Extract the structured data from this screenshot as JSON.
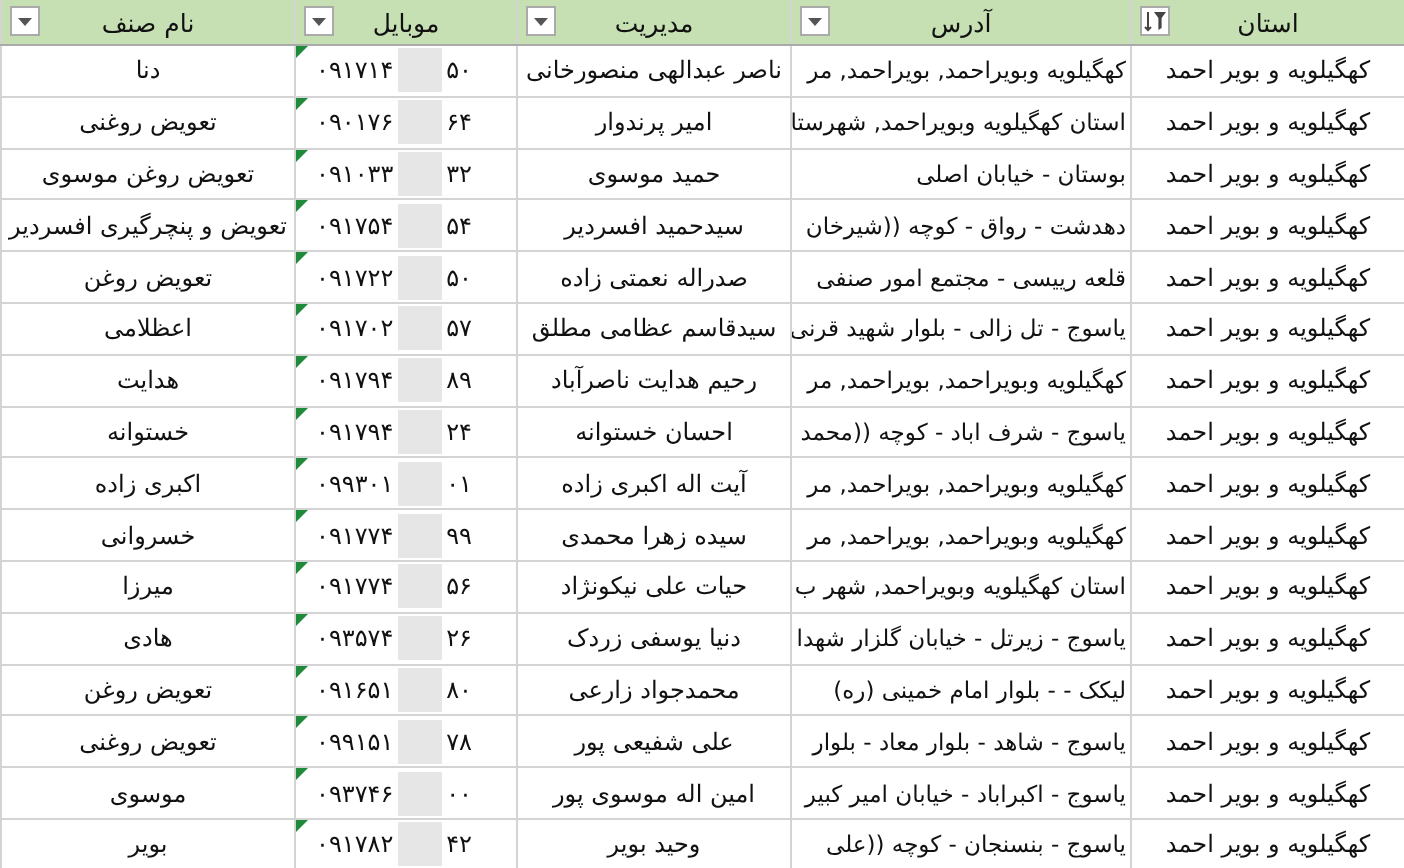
{
  "table": {
    "columns": [
      {
        "label": "استان",
        "sorted": true
      },
      {
        "label": "آدرس",
        "sorted": false
      },
      {
        "label": "مدیریت",
        "sorted": false
      },
      {
        "label": "موبایل",
        "sorted": false
      },
      {
        "label": "نام صنف",
        "sorted": false
      }
    ],
    "rows": [
      {
        "province": "کهگیلویه و بویر احمد",
        "address": "کهگیلویه وبویراحمد, بویراحمد, مر",
        "manager": "ناصر عبدالهی منصورخانی",
        "mobile_start": "۰۹۱۷۱۴",
        "mobile_end": "۵۰",
        "business": "دنا"
      },
      {
        "province": "کهگیلویه و بویر احمد",
        "address": "استان کهگیلویه وبویراحمد, شهرستا",
        "manager": "امیر پرندوار",
        "mobile_start": "۰۹۰۱۷۶",
        "mobile_end": "۶۴",
        "business": "تعویض روغنی"
      },
      {
        "province": "کهگیلویه و بویر احمد",
        "address": "بوستان  - خیابان اصلی",
        "manager": "حمید موسوی",
        "mobile_start": "۰۹۱۰۳۳",
        "mobile_end": "۳۲",
        "business": "تعویض روغن موسوی"
      },
      {
        "province": "کهگیلویه و بویر احمد",
        "address": "دهدشت - رواق - کوچه ((شیرخان",
        "manager": "سیدحمید افسردیر",
        "mobile_start": "۰۹۱۷۵۴",
        "mobile_end": "۵۴",
        "business": "تعویض و پنچرگیری افسردیر"
      },
      {
        "province": "کهگیلویه و بویر احمد",
        "address": "قلعه رییسی - مجتمع امور صنفی",
        "manager": "صدراله نعمتی زاده",
        "mobile_start": "۰۹۱۷۲۲",
        "mobile_end": "۵۰",
        "business": "تعویض روغن"
      },
      {
        "province": "کهگیلویه و بویر احمد",
        "address": "یاسوج - تل زالی - بلوار شهید قرنی",
        "manager": "سیدقاسم عظامی مطلق",
        "mobile_start": "۰۹۱۷۰۲",
        "mobile_end": "۵۷",
        "business": "اعظلامی"
      },
      {
        "province": "کهگیلویه و بویر احمد",
        "address": "کهگیلویه وبویراحمد, بویراحمد, مر",
        "manager": "رحیم هدایت ناصرآباد",
        "mobile_start": "۰۹۱۷۹۴",
        "mobile_end": "۸۹",
        "business": "هدایت"
      },
      {
        "province": "کهگیلویه و بویر احمد",
        "address": "یاسوج - شرف اباد - کوچه ((محمد",
        "manager": "احسان خستوانه",
        "mobile_start": "۰۹۱۷۹۴",
        "mobile_end": "۲۴",
        "business": "خستوانه"
      },
      {
        "province": "کهگیلویه و بویر احمد",
        "address": "کهگیلویه وبویراحمد, بویراحمد, مر",
        "manager": "آیت اله اکبری زاده",
        "mobile_start": "۰۹۹۳۰۱",
        "mobile_end": "۰۱",
        "business": "اکبری زاده"
      },
      {
        "province": "کهگیلویه و بویر احمد",
        "address": "کهگیلویه وبویراحمد, بویراحمد, مر",
        "manager": "سیده زهرا محمدی",
        "mobile_start": "۰۹۱۷۷۴",
        "mobile_end": "۹۹",
        "business": "خسروانی"
      },
      {
        "province": "کهگیلویه و بویر احمد",
        "address": "استان کهگیلویه وبویراحمد,  شهر ب",
        "manager": "حیات علی نیکونژاد",
        "mobile_start": "۰۹۱۷۷۴",
        "mobile_end": "۵۶",
        "business": "میرزا"
      },
      {
        "province": "کهگیلویه و بویر احمد",
        "address": "یاسوج - زیرتل - خیابان گلزار شهدا",
        "manager": "دنیا یوسفی زردک",
        "mobile_start": "۰۹۳۵۷۴",
        "mobile_end": "۲۶",
        "business": "هادی"
      },
      {
        "province": "کهگیلویه و بویر احمد",
        "address": "لیکک -  - بلوار امام خمینی (ره)",
        "manager": "محمدجواد زارعی",
        "mobile_start": "۰۹۱۶۵۱",
        "mobile_end": "۸۰",
        "business": "تعویض روغن"
      },
      {
        "province": "کهگیلویه و بویر احمد",
        "address": "یاسوج - شاهد - بلوار معاد - بلوار",
        "manager": "علی شفیعی پور",
        "mobile_start": "۰۹۹۱۵۱",
        "mobile_end": "۷۸",
        "business": "تعویض روغنی"
      },
      {
        "province": "کهگیلویه و بویر احمد",
        "address": "یاسوج - اکبراباد - خیابان امیر کبیر",
        "manager": "امین اله موسوی پور",
        "mobile_start": "۰۹۳۷۴۶",
        "mobile_end": "۰۰",
        "business": "موسوی"
      },
      {
        "province": "کهگیلویه و بویر احمد",
        "address": "یاسوج - بنسنجان - کوچه ((علی",
        "manager": "وحید بویر",
        "mobile_start": "۰۹۱۷۸۲",
        "mobile_end": "۴۲",
        "business": "بویر"
      }
    ]
  }
}
